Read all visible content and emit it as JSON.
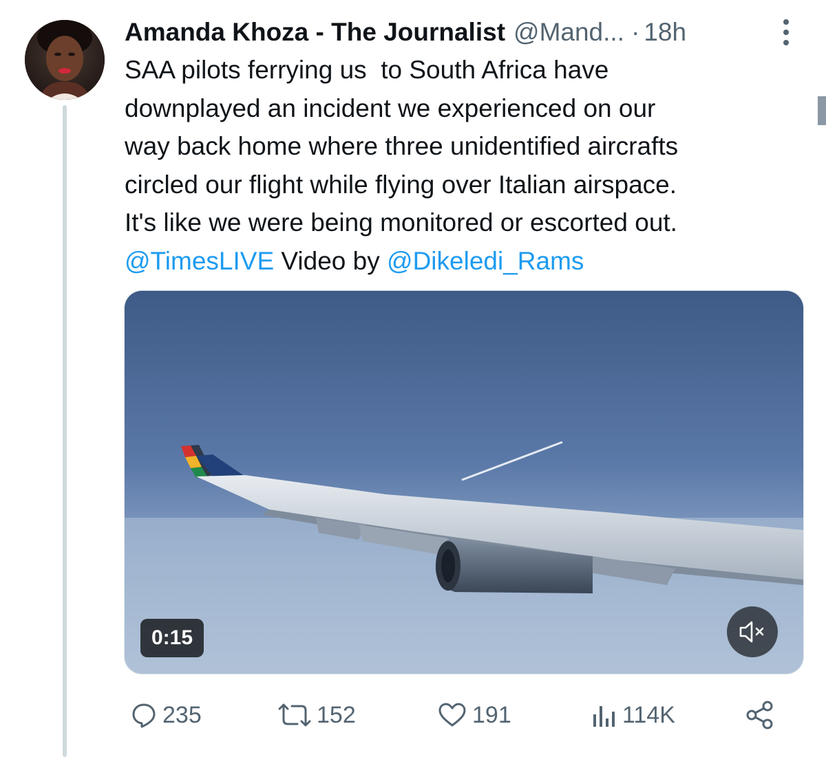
{
  "tweet": {
    "author_name": "Amanda Khoza - The Journalist",
    "handle": "@Mand...",
    "separator": "·",
    "time": "18h",
    "text_lines": [
      [
        {
          "t": "SAA pilots ferrying us  to South Africa have",
          "link": false
        }
      ],
      [
        {
          "t": "downplayed an incident we experienced on our",
          "link": false
        }
      ],
      [
        {
          "t": "way back home where three unidentified aircrafts",
          "link": false
        }
      ],
      [
        {
          "t": "circled our flight while flying over Italian airspace.",
          "link": false
        }
      ],
      [
        {
          "t": "It's like we were being monitored or escorted out.",
          "link": false
        }
      ],
      [
        {
          "t": "@TimesLIVE",
          "link": true
        },
        {
          "t": " Video by ",
          "link": false
        },
        {
          "t": "@Dikeledi_Rams",
          "link": true
        }
      ]
    ]
  },
  "media": {
    "duration": "0:15",
    "mute_icon": "speaker-muted-icon"
  },
  "actions": {
    "replies": "235",
    "reposts": "152",
    "likes": "191",
    "views": "114K"
  },
  "colors": {
    "link": "#1d9bf0",
    "secondary_text": "#536471",
    "thread_line": "#cfd9de"
  },
  "icons": {
    "more": "more-vertical-icon",
    "reply": "reply-bubble-icon",
    "repost": "repost-icon",
    "like": "heart-icon",
    "views": "views-bar-chart-icon",
    "share": "share-nodes-icon"
  }
}
